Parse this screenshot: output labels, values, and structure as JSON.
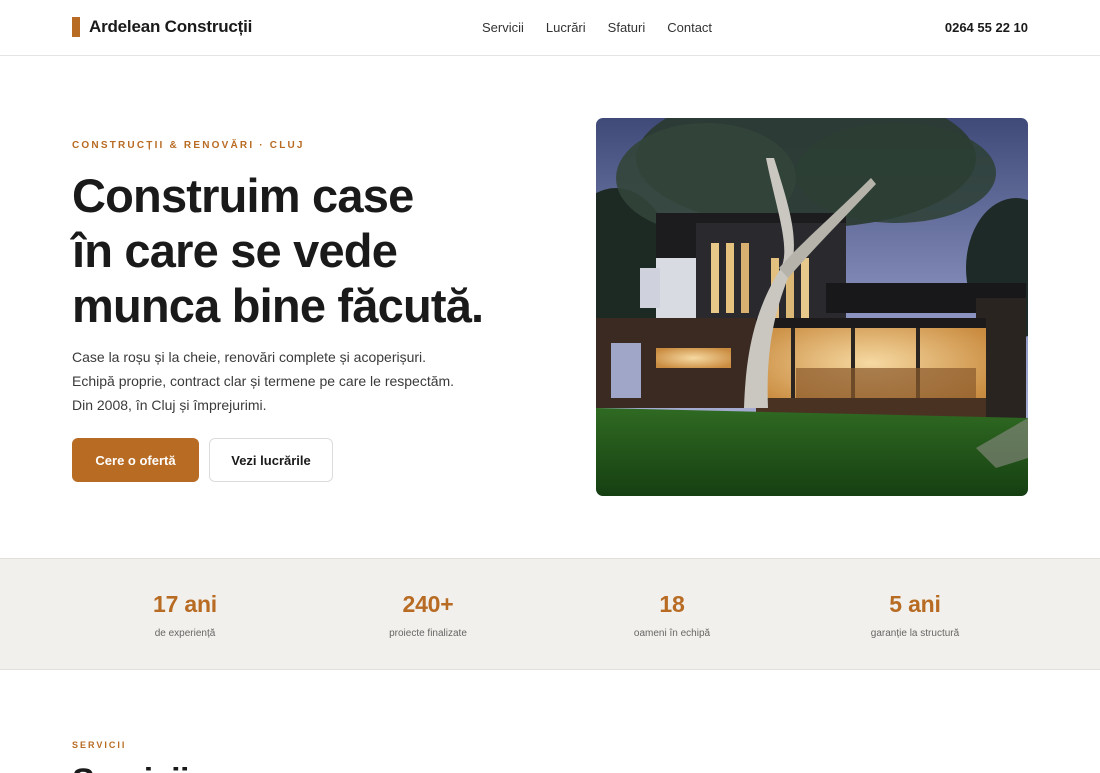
{
  "brand": {
    "name": "Ardelean Construcții",
    "accent_color": "#b86b23"
  },
  "nav": {
    "items": [
      {
        "label": "Servicii"
      },
      {
        "label": "Lucrări"
      },
      {
        "label": "Sfaturi"
      },
      {
        "label": "Contact"
      }
    ]
  },
  "header": {
    "phone": "0264 55 22 10"
  },
  "hero": {
    "eyebrow": "CONSTRUCȚII & RENOVĂRI · CLUJ",
    "headline_lines": [
      "Construim case",
      "în care se vede",
      "munca bine făcută."
    ],
    "lead_lines": [
      "Case la roșu și la cheie, renovări complete și acoperișuri.",
      "Echipă proprie, contract clar și termene pe care le respectăm.",
      "Din 2008, în Cluj și împrejurimi."
    ],
    "primary_button": "Cere o ofertă",
    "secondary_button": "Vezi lucrările",
    "image_subject": "modern-house-photo"
  },
  "stats": [
    {
      "value": "17 ani",
      "label": "de experiență"
    },
    {
      "value": "240+",
      "label": "proiecte finalizate"
    },
    {
      "value": "18",
      "label": "oameni în echipă"
    },
    {
      "value": "5 ani",
      "label": "garanție la structură"
    }
  ],
  "services": {
    "eyebrow": "SERVICII",
    "title": "Servicii"
  }
}
